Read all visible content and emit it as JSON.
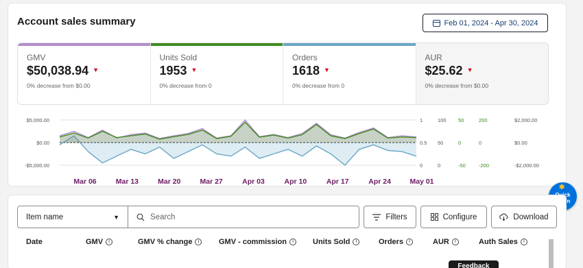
{
  "summary": {
    "title": "Account sales summary",
    "date_range": "Feb 01, 2024 - Apr 30, 2024"
  },
  "kpis": [
    {
      "label": "GMV",
      "value": "$50,038.94",
      "change": "0% decrease from $0.00",
      "color": "#b28ecb"
    },
    {
      "label": "Units Sold",
      "value": "1953",
      "change": "0% decrease from 0",
      "color": "#3e8a1e"
    },
    {
      "label": "Orders",
      "value": "1618",
      "change": "0% decrease from 0",
      "color": "#6ba7c7"
    },
    {
      "label": "AUR",
      "value": "$25.62",
      "change": "0% decrease from $0.00",
      "color": "#e3e3e3"
    }
  ],
  "chart_data": {
    "type": "line",
    "x": [
      "Mar 06",
      "Mar 13",
      "Mar 20",
      "Mar 27",
      "Apr 03",
      "Apr 10",
      "Apr 17",
      "Apr 24",
      "May 01"
    ],
    "left_axis_ticks": [
      "$5,000.00",
      "$0.00",
      "-$5,000.00"
    ],
    "right_axes": [
      {
        "ticks": [
          "1",
          "0.5",
          "0"
        ]
      },
      {
        "ticks": [
          "100",
          "50",
          "0"
        ]
      },
      {
        "ticks": [
          "50",
          "0",
          "-50"
        ]
      },
      {
        "ticks": [
          "200",
          "0",
          "-200"
        ]
      },
      {
        "ticks": [
          "$2,000.00",
          "$0.00",
          "-$2,000.00"
        ]
      }
    ],
    "series": [
      {
        "values": [
          0.25,
          0.42,
          0.2,
          0.5,
          0.22,
          0.3,
          0.38,
          0.15,
          0.26,
          0.36,
          0.55,
          0.18,
          0.28,
          0.9,
          0.24,
          0.33,
          0.2,
          0.35,
          0.8,
          0.3,
          0.18,
          0.4,
          0.6,
          0.2,
          0.25,
          0.22
        ],
        "color": "#3e8a1e"
      },
      {
        "values": [
          0.3,
          0.5,
          0.22,
          0.55,
          0.2,
          0.35,
          0.42,
          0.18,
          0.3,
          0.4,
          0.62,
          0.2,
          0.3,
          1.0,
          0.26,
          0.36,
          0.22,
          0.4,
          0.85,
          0.35,
          0.2,
          0.45,
          0.65,
          0.22,
          0.3,
          0.25
        ],
        "color": "#b28ecb"
      },
      {
        "values": [
          -0.1,
          0.3,
          -0.4,
          -0.9,
          -0.6,
          -0.3,
          -0.5,
          -0.2,
          -0.7,
          -0.4,
          -0.1,
          -0.5,
          -0.6,
          -0.2,
          -0.7,
          -0.5,
          -0.3,
          -0.6,
          -0.15,
          -0.5,
          -1.0,
          -0.3,
          -0.1,
          -0.35,
          -0.4,
          -0.6
        ],
        "color": "#6ba7c7"
      }
    ],
    "legend": "none",
    "grid": false
  },
  "toolbar": {
    "item_select": "Item name",
    "search_placeholder": "Search",
    "filters": "Filters",
    "configure": "Configure",
    "download": "Download"
  },
  "table": {
    "columns": [
      "Date",
      "GMV",
      "GMV % change",
      "GMV - commission",
      "Units Sold",
      "Orders",
      "AUR",
      "Auth Sales"
    ]
  },
  "quick_learn": {
    "line1": "Quick",
    "line2": "Learn"
  },
  "feedback": "Feedback",
  "colors": {
    "accent": "#0071dc",
    "decrease": "#d0021b",
    "axis_month": "#6b1a63"
  }
}
